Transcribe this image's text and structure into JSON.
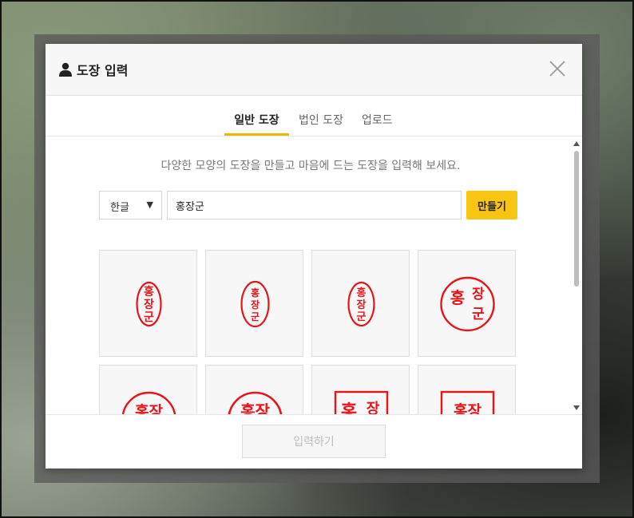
{
  "modal": {
    "title": "도장 입력",
    "tabs": [
      {
        "label": "일반 도장",
        "active": true
      },
      {
        "label": "법인 도장",
        "active": false
      },
      {
        "label": "업로드",
        "active": false
      }
    ],
    "description": "다양한 모양의 도장을 만들고 마음에 드는 도장을 입력해 보세요.",
    "language_select": {
      "value": "한글"
    },
    "name_input": {
      "value": "홍장군"
    },
    "make_button": "만들기",
    "submit_button": "입력하기"
  },
  "stamps": [
    {
      "shape": "ellipse-narrow",
      "style": "seal-script",
      "text": "홍장군"
    },
    {
      "shape": "ellipse",
      "style": "plain",
      "text": "홍장군"
    },
    {
      "shape": "ellipse-narrow",
      "style": "bold",
      "text": "홍장군"
    },
    {
      "shape": "circle",
      "style": "seal-script",
      "text": "홍장군"
    },
    {
      "shape": "circle",
      "style": "plain",
      "text": "홍장군"
    },
    {
      "shape": "circle",
      "style": "bold",
      "text": "홍장군"
    },
    {
      "shape": "square",
      "style": "seal-script",
      "text": "홍장군"
    },
    {
      "shape": "square",
      "style": "plain",
      "text": "홍장군"
    }
  ],
  "colors": {
    "accent": "#f9c513",
    "stamp": "#e8141b",
    "overlay": "#5a5a5a"
  }
}
